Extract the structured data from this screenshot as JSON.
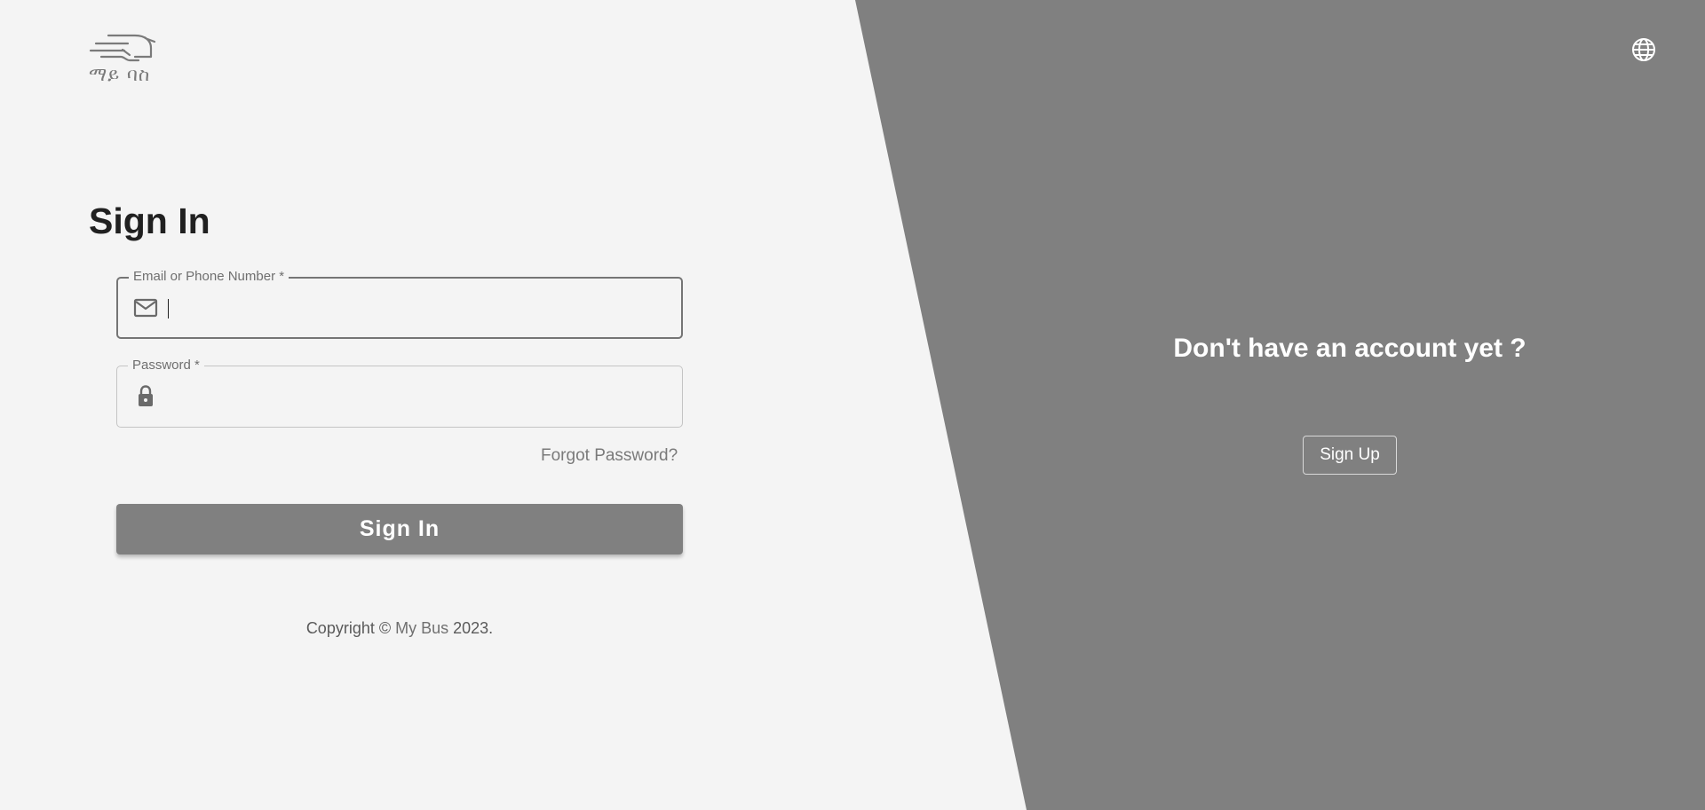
{
  "brand": {
    "logo_text": "ማይ ባስ",
    "logo_icon": "bus-speed-icon"
  },
  "signin": {
    "title": "Sign In",
    "email_label": "Email or Phone Number *",
    "email_value": "",
    "email_icon": "mail-icon",
    "password_label": "Password *",
    "password_value": "",
    "password_icon": "lock-icon",
    "forgot_label": "Forgot Password?",
    "submit_label": "Sign In"
  },
  "footer": {
    "copyright_prefix": "Copyright © ",
    "copyright_brand": "My Bus",
    "copyright_suffix": " 2023."
  },
  "signup_panel": {
    "prompt": "Don't have an account yet ?",
    "button_label": "Sign Up",
    "language_icon": "globe-icon"
  },
  "colors": {
    "background": "#f4f4f4",
    "panel": "#808080",
    "button": "#808080",
    "title": "#202020"
  }
}
